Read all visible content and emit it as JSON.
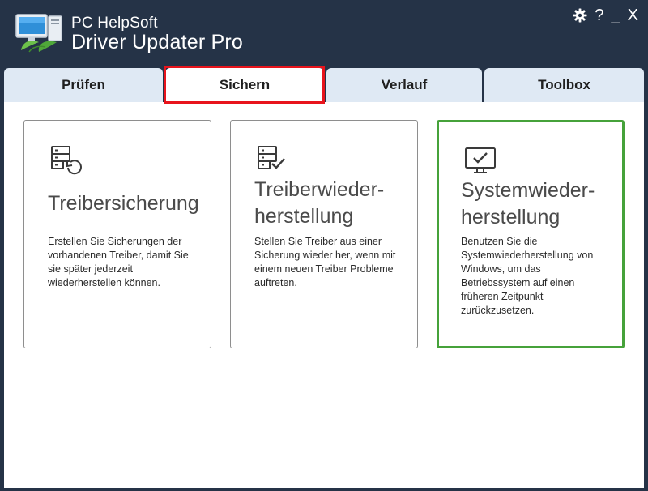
{
  "app": {
    "title_line1": "PC HelpSoft",
    "title_line2": "Driver Updater Pro"
  },
  "window_controls": {
    "settings_icon": "gear-icon",
    "help_label": "?",
    "minimize_label": "_",
    "close_label": "X"
  },
  "tabs": [
    {
      "label": "Prüfen",
      "active": false
    },
    {
      "label": "Sichern",
      "active": true
    },
    {
      "label": "Verlauf",
      "active": false
    },
    {
      "label": "Toolbox",
      "active": false
    }
  ],
  "cards": [
    {
      "title": "Treibersicherung",
      "description": "Erstellen Sie Sicherungen der vorhandenen Treiber, damit Sie sie später jederzeit wiederherstellen können.",
      "icon": "driver-backup-icon",
      "selected": false
    },
    {
      "title_line1": "Treiberwieder-",
      "title_line2": "herstellung",
      "description": "Stellen Sie Treiber aus einer Sicherung wieder her, wenn mit einem neuen Treiber Probleme auftreten.",
      "icon": "driver-restore-icon",
      "selected": false
    },
    {
      "title_line1": "Systemwieder-",
      "title_line2": "herstellung",
      "description": "Benutzen Sie die Systemwiederherstellung von Windows, um das Betriebssystem auf einen früheren Zeitpunkt zurückzusetzen.",
      "icon": "system-restore-icon",
      "selected": true
    }
  ],
  "colors": {
    "header_bg": "#253347",
    "tab_bg": "#dfe9f4",
    "highlight_red": "#e8141c",
    "selected_green": "#46a23a"
  }
}
